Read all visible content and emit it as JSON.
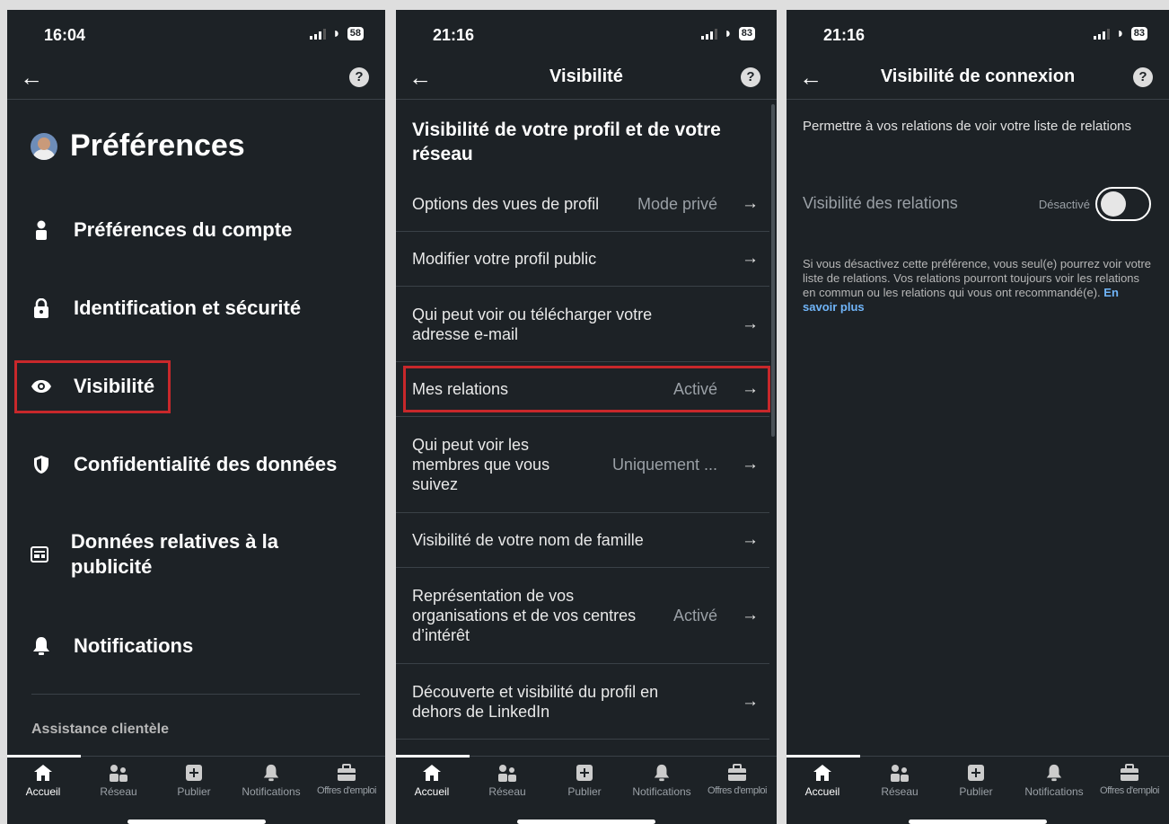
{
  "colors": {
    "background": "#1d2226",
    "highlight": "#c8282b",
    "link": "#70b5f9",
    "muted": "#9aa0a6"
  },
  "nav_items": [
    {
      "label": "Accueil",
      "icon": "home-icon"
    },
    {
      "label": "Réseau",
      "icon": "network-icon"
    },
    {
      "label": "Publier",
      "icon": "post-icon"
    },
    {
      "label": "Notifications",
      "icon": "bell-icon"
    },
    {
      "label": "Offres d'emploi",
      "icon": "briefcase-icon"
    }
  ],
  "panel1": {
    "time": "16:04",
    "battery": "58",
    "title": "Préférences",
    "items": [
      {
        "label": "Préférences du compte",
        "icon": "person-icon"
      },
      {
        "label": "Identification et sécurité",
        "icon": "lock-icon"
      },
      {
        "label": "Visibilité",
        "icon": "eye-icon",
        "highlighted": true
      },
      {
        "label": "Confidentialité des données",
        "icon": "shield-icon"
      },
      {
        "label": "Données relatives à la publicité",
        "icon": "ad-icon"
      },
      {
        "label": "Notifications",
        "icon": "bell-icon"
      }
    ],
    "section_label": "Assistance clientèle"
  },
  "panel2": {
    "time": "21:16",
    "battery": "83",
    "title": "Visibilité",
    "heading": "Visibilité de votre profil et de votre réseau",
    "rows": [
      {
        "label": "Options des vues de profil",
        "value": "Mode privé"
      },
      {
        "label": "Modifier votre profil public",
        "value": ""
      },
      {
        "label": "Qui peut voir ou télécharger votre adresse e-mail",
        "value": ""
      },
      {
        "label": "Mes relations",
        "value": "Activé",
        "highlighted": true
      },
      {
        "label": "Qui peut voir les membres que vous suivez",
        "value": "Uniquement ..."
      },
      {
        "label": "Visibilité de votre nom de famille",
        "value": ""
      },
      {
        "label": "Représentation de vos organisations et de vos centres d’intérêt",
        "value": "Activé"
      },
      {
        "label": "Découverte et visibilité du profil en dehors de LinkedIn",
        "value": ""
      }
    ]
  },
  "panel3": {
    "time": "21:16",
    "battery": "83",
    "title": "Visibilité de connexion",
    "description": "Permettre à vos relations de voir votre liste de relations",
    "setting_label": "Visibilité des relations",
    "setting_value": "Désactivé",
    "toggle_on": false,
    "note": "Si vous désactivez cette préférence, vous seul(e) pourrez voir votre liste de relations. Vos relations pourront toujours voir les relations en commun ou les relations qui vous ont recommandé(e).",
    "link": "En savoir plus"
  }
}
